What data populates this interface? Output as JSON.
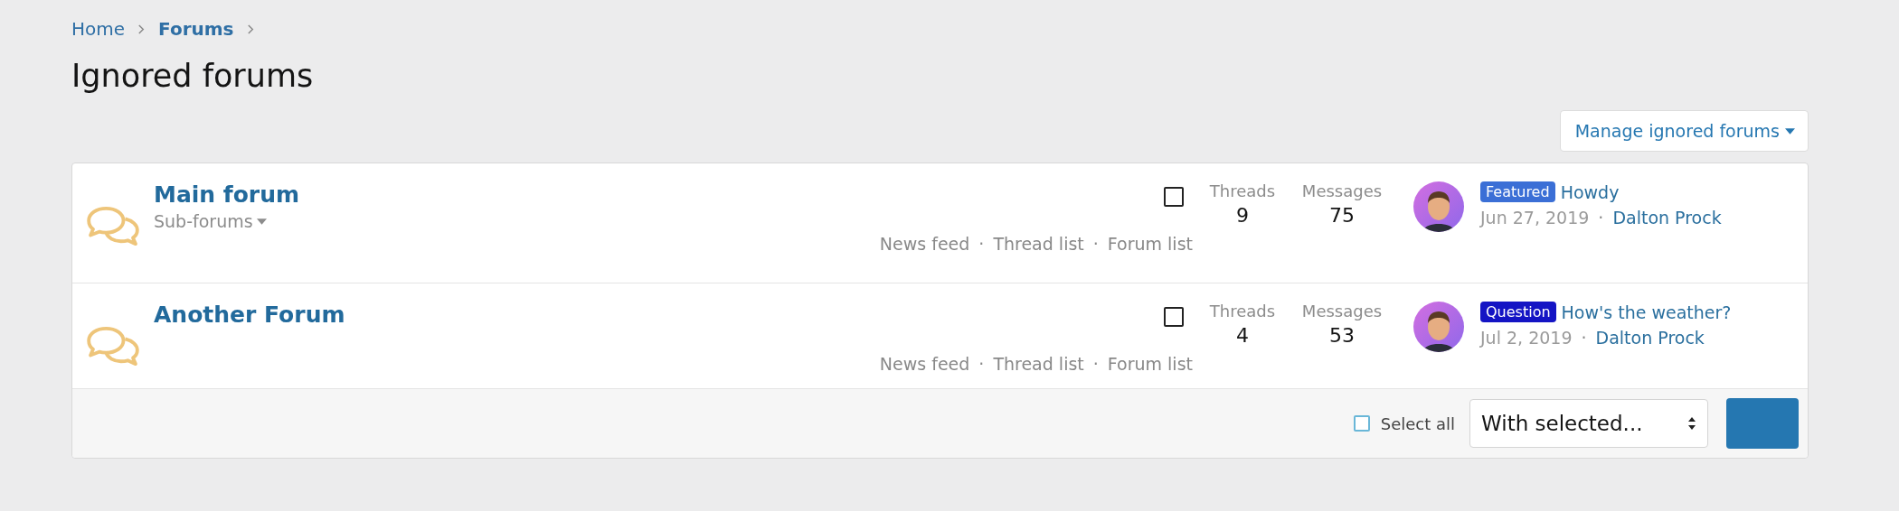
{
  "breadcrumb": [
    {
      "label": "Home",
      "current": false
    },
    {
      "label": "Forums",
      "current": true
    }
  ],
  "title": "Ignored forums",
  "manage_button": "Manage ignored forums",
  "forums": [
    {
      "separator": "·",
      "name": "Main forum",
      "subforums": "Sub-forums",
      "links": [
        "News feed",
        "Thread list",
        "Forum list"
      ],
      "checked": false,
      "threads_label": "Threads",
      "threads": "9",
      "messages_label": "Messages",
      "messages": "75",
      "badge": {
        "label": "Featured",
        "color": "#3b6fd6"
      },
      "thread": "Howdy",
      "date": "Jun 27, 2019",
      "author": "Dalton Prock"
    },
    {
      "separator": "·",
      "name": "Another Forum",
      "links": [
        "News feed",
        "Thread list",
        "Forum list"
      ],
      "checked": false,
      "threads_label": "Threads",
      "threads": "4",
      "messages_label": "Messages",
      "messages": "53",
      "badge": {
        "label": "Question",
        "color": "#1414c4"
      },
      "thread": "How's the weather?",
      "date": "Jul 2, 2019",
      "author": "Dalton Prock"
    }
  ],
  "footer": {
    "select_all": "Select all",
    "select_all_checked": false,
    "action_placeholder": "With selected..."
  }
}
